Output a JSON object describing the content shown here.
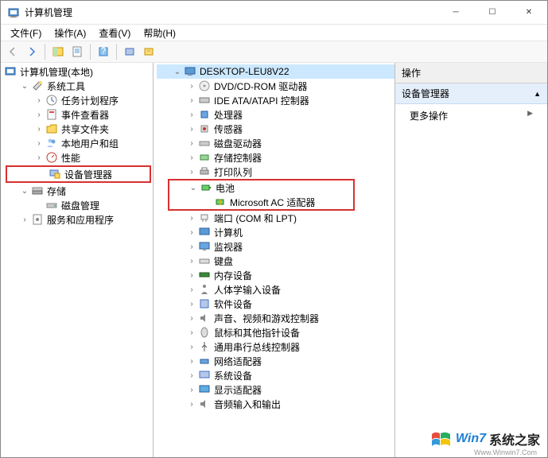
{
  "window": {
    "title": "计算机管理"
  },
  "menu": {
    "file": "文件(F)",
    "action": "操作(A)",
    "view": "查看(V)",
    "help": "帮助(H)"
  },
  "left_tree": {
    "root": "计算机管理(本地)",
    "system_tools": "系统工具",
    "task_scheduler": "任务计划程序",
    "event_viewer": "事件查看器",
    "shared_folders": "共享文件夹",
    "local_users": "本地用户和组",
    "performance": "性能",
    "device_manager": "设备管理器",
    "storage": "存储",
    "disk_mgmt": "磁盘管理",
    "services_apps": "服务和应用程序"
  },
  "mid_tree": {
    "computer": "DESKTOP-LEU8V22",
    "dvd": "DVD/CD-ROM 驱动器",
    "ide": "IDE ATA/ATAPI 控制器",
    "cpu": "处理器",
    "sensor": "传感器",
    "disk": "磁盘驱动器",
    "storage_ctrl": "存储控制器",
    "print_queue": "打印队列",
    "battery": "电池",
    "ac_adapter": "Microsoft AC 适配器",
    "ports": "端口 (COM 和 LPT)",
    "computers": "计算机",
    "monitors": "监视器",
    "keyboards": "键盘",
    "memory": "内存设备",
    "hid": "人体学输入设备",
    "software": "软件设备",
    "sound": "声音、视频和游戏控制器",
    "mouse": "鼠标和其他指针设备",
    "usb": "通用串行总线控制器",
    "network": "网络适配器",
    "system": "系统设备",
    "display": "显示适配器",
    "audio_io": "音频输入和输出"
  },
  "right": {
    "header": "操作",
    "section": "设备管理器",
    "more": "更多操作"
  },
  "watermark": {
    "brand1": "Win7",
    "brand2": "系统之家",
    "url": "Www.Winwin7.Com"
  }
}
